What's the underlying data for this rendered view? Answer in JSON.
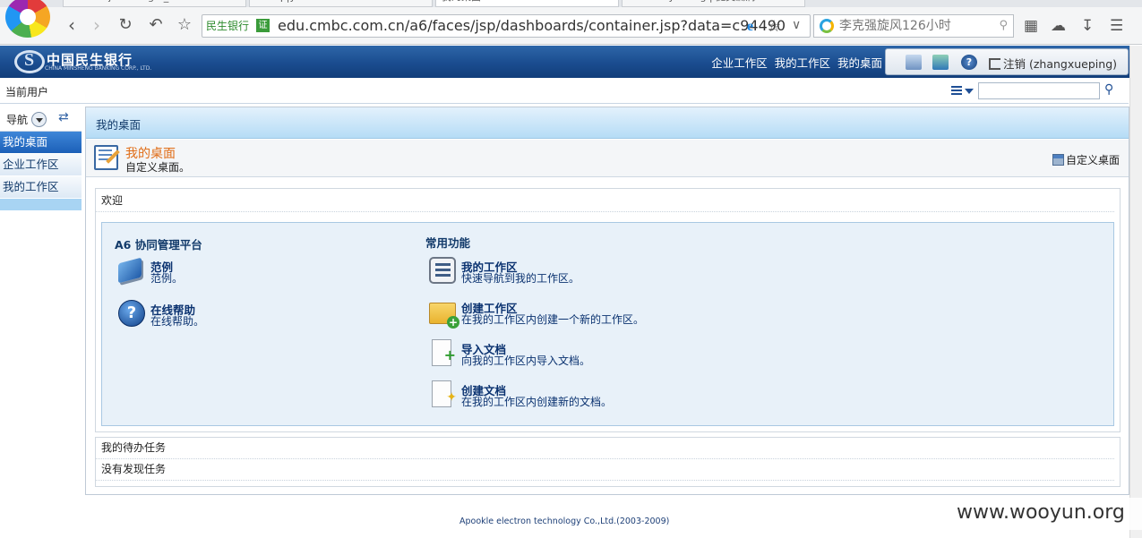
{
  "browser": {
    "tabs": [
      "maabsf:j mankagm_ ",
      "...ntcp|y... ",
      "我的桌面",
      "www.wuyun.org | 提交漏洞..."
    ],
    "address": {
      "bank_label": "民生银行",
      "cert_label": "证",
      "url": "edu.cmbc.com.cn/a6/faces/jsp/dashboards/container.jsp?data=c94490"
    },
    "search_placeholder": "李克强旋风126小时"
  },
  "header": {
    "logo_cn": "中国民生银行",
    "logo_en": "CHINA MINSHENG BANKING CORP., LTD.",
    "links": [
      "企业工作区",
      "我的工作区",
      "我的桌面"
    ],
    "logout_label": "注销 (zhangxueping)"
  },
  "userbar": {
    "current_user_label": "当前用户",
    "search_value": ""
  },
  "sidebar": {
    "title": "导航",
    "items": [
      {
        "label": "我的桌面",
        "active": true
      },
      {
        "label": "企业工作区",
        "active": false
      },
      {
        "label": "我的工作区",
        "active": false
      }
    ]
  },
  "main": {
    "title": "我的桌面",
    "page_title": "我的桌面",
    "page_subtitle": "自定义桌面。",
    "customize_label": "自定义桌面",
    "welcome_title": "欢迎",
    "left_column": {
      "title": "A6 协同管理平台",
      "items": [
        {
          "name": "范例",
          "desc": "范例。",
          "icon": "book-icon"
        },
        {
          "name": "在线帮助",
          "desc": "在线帮助。",
          "icon": "help-icon"
        }
      ]
    },
    "right_column": {
      "title": "常用功能",
      "items": [
        {
          "name": "我的工作区",
          "desc": "快速导航到我的工作区。",
          "icon": "list-icon"
        },
        {
          "name": "创建工作区",
          "desc": "在我的工作区内创建一个新的工作区。",
          "icon": "folder-add-icon"
        },
        {
          "name": "导入文档",
          "desc": "向我的工作区内导入文档。",
          "icon": "document-import-icon"
        },
        {
          "name": "创建文档",
          "desc": "在我的工作区内创建新的文档。",
          "icon": "document-new-icon"
        }
      ]
    },
    "tasks_title": "我的待办任务",
    "tasks_empty": "没有发现任务"
  },
  "footer": "Apookle electron technology Co.,Ltd.(2003-2009)",
  "watermark": "www.wooyun.org",
  "colors": {
    "header_blue": "#1a4c8f",
    "sidebar_active": "#1c60b8",
    "page_title_orange": "#e06d17",
    "panel_bg": "#e8f1f9"
  }
}
